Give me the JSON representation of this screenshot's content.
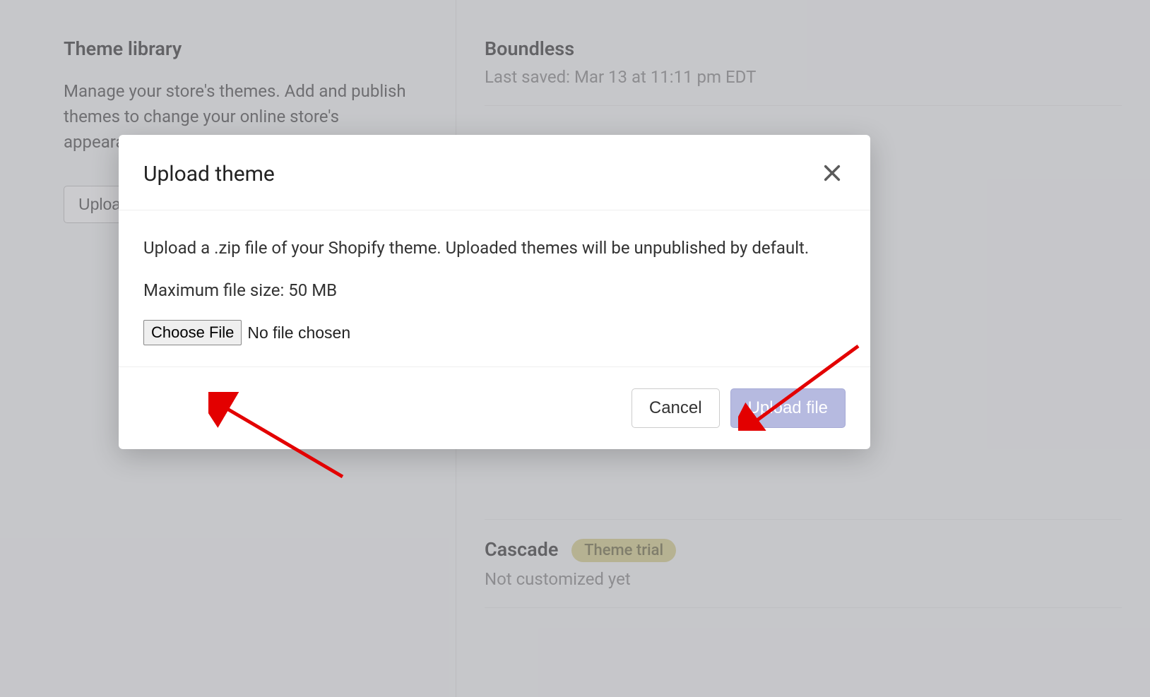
{
  "page": {
    "theme_library_title": "Theme library",
    "theme_library_description": "Manage your store's themes. Add and publish themes to change your online store's appearance.",
    "upload_theme_button": "Upload theme"
  },
  "themes": {
    "boundless": {
      "name": "Boundless",
      "saved": "Last saved: Mar 13 at 11:11 pm EDT"
    },
    "cascade": {
      "name": "Cascade",
      "badge": "Theme trial",
      "status": "Not customized yet"
    }
  },
  "modal": {
    "title": "Upload theme",
    "instructions": "Upload a .zip file of your Shopify theme. Uploaded themes will be unpublished by default.",
    "max_file_size": "Maximum file size: 50 MB",
    "choose_file_label": "Choose File",
    "file_status": "No file chosen",
    "cancel_label": "Cancel",
    "upload_label": "Upload file"
  }
}
